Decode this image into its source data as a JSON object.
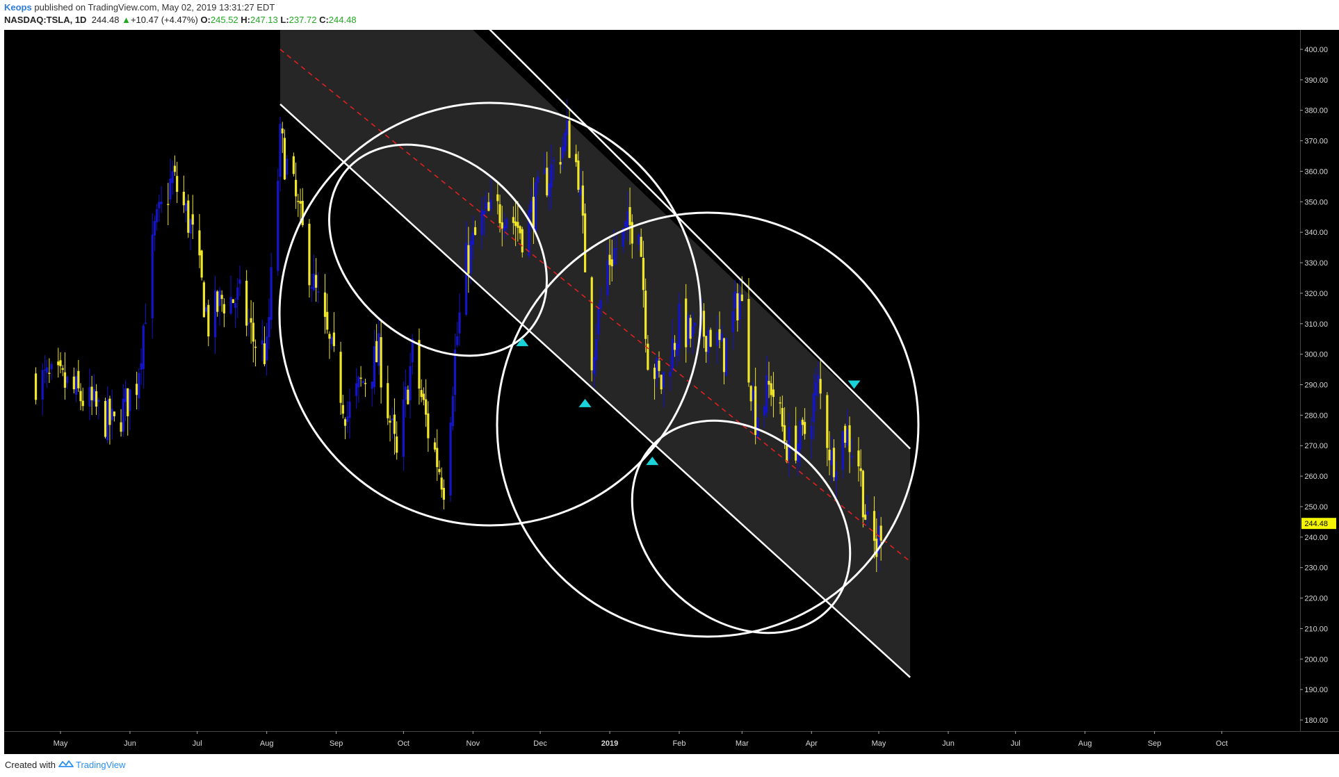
{
  "header": {
    "author": "Keops",
    "published": "published on TradingView.com, May 02, 2019 13:31:27 EDT",
    "symbol": "NASDAQ:TSLA, 1D",
    "last": "244.48",
    "change": "+10.47 (+4.47%)",
    "open_label": "O:",
    "open": "245.52",
    "high_label": "H:",
    "high": "247.13",
    "low_label": "L:",
    "low": "237.72",
    "close_label": "C:",
    "close": "244.48"
  },
  "footer": {
    "created_with": "Created with",
    "brand": "TradingView"
  },
  "colors": {
    "background": "#000000",
    "up_candle": "#1414c8",
    "down_candle": "#f0e62a",
    "channel_fill": "#262626",
    "lines": "#ffffff",
    "midline": "#e02020",
    "arrows": "#19d3d8",
    "price_badge": "#f5f500"
  },
  "chart_data": {
    "type": "candlestick",
    "symbol": "NASDAQ:TSLA",
    "interval": "1D",
    "ylim": [
      175,
      405
    ],
    "y_ticks": [
      180,
      190,
      200,
      210,
      220,
      230,
      240,
      250,
      260,
      270,
      280,
      290,
      300,
      310,
      320,
      330,
      340,
      350,
      360,
      370,
      380,
      390,
      400
    ],
    "x_ticks": [
      "May",
      "Jun",
      "Jul",
      "Aug",
      "Sep",
      "Oct",
      "Nov",
      "Dec",
      "2019",
      "Feb",
      "Mar",
      "Apr",
      "May",
      "Jun",
      "Jul",
      "Aug",
      "Sep",
      "Oct"
    ],
    "x_tick_dates": [
      "2018-05-01",
      "2018-06-01",
      "2018-07-01",
      "2018-08-01",
      "2018-09-01",
      "2018-10-01",
      "2018-11-01",
      "2018-12-01",
      "2019-01-01",
      "2019-02-01",
      "2019-03-01",
      "2019-04-01",
      "2019-05-01",
      "2019-06-01",
      "2019-07-01",
      "2019-08-01",
      "2019-09-01",
      "2019-10-01"
    ],
    "last_price": 244.48,
    "price_path": [
      [
        "2018-04-20",
        292
      ],
      [
        "2018-05-03",
        290
      ],
      [
        "2018-05-15",
        283
      ],
      [
        "2018-05-25",
        276
      ],
      [
        "2018-06-04",
        291
      ],
      [
        "2018-06-12",
        340
      ],
      [
        "2018-06-20",
        358
      ],
      [
        "2018-06-28",
        342
      ],
      [
        "2018-07-06",
        310
      ],
      [
        "2018-07-12",
        318
      ],
      [
        "2018-07-20",
        318
      ],
      [
        "2018-07-26",
        305
      ],
      [
        "2018-08-01",
        300
      ],
      [
        "2018-08-07",
        370
      ],
      [
        "2018-08-14",
        350
      ],
      [
        "2018-08-22",
        322
      ],
      [
        "2018-08-29",
        302
      ],
      [
        "2018-09-06",
        280
      ],
      [
        "2018-09-12",
        290
      ],
      [
        "2018-09-20",
        300
      ],
      [
        "2018-09-28",
        265
      ],
      [
        "2018-10-05",
        300
      ],
      [
        "2018-10-12",
        275
      ],
      [
        "2018-10-19",
        258
      ],
      [
        "2018-10-24",
        300
      ],
      [
        "2018-10-29",
        330
      ],
      [
        "2018-11-05",
        344
      ],
      [
        "2018-11-15",
        348
      ],
      [
        "2018-11-23",
        340
      ],
      [
        "2018-11-29",
        350
      ],
      [
        "2018-12-07",
        362
      ],
      [
        "2018-12-13",
        372
      ],
      [
        "2018-12-18",
        360
      ],
      [
        "2018-12-24",
        300
      ],
      [
        "2018-12-31",
        330
      ],
      [
        "2019-01-08",
        340
      ],
      [
        "2019-01-14",
        345
      ],
      [
        "2019-01-18",
        300
      ],
      [
        "2019-01-24",
        290
      ],
      [
        "2019-02-01",
        310
      ],
      [
        "2019-02-07",
        305
      ],
      [
        "2019-02-14",
        308
      ],
      [
        "2019-02-21",
        300
      ],
      [
        "2019-02-28",
        320
      ],
      [
        "2019-03-07",
        280
      ],
      [
        "2019-03-14",
        290
      ],
      [
        "2019-03-21",
        270
      ],
      [
        "2019-03-28",
        272
      ],
      [
        "2019-04-04",
        290
      ],
      [
        "2019-04-10",
        265
      ],
      [
        "2019-04-16",
        275
      ],
      [
        "2019-04-22",
        265
      ],
      [
        "2019-04-26",
        242
      ],
      [
        "2019-04-30",
        236
      ],
      [
        "2019-05-02",
        244.48
      ]
    ],
    "drawings": {
      "channel_upper": [
        [
          "2018-11-01",
          412
        ],
        [
          "2019-05-15",
          269
        ]
      ],
      "channel_lower": [
        [
          "2018-08-07",
          382
        ],
        [
          "2019-05-15",
          194
        ]
      ],
      "channel_mid": [
        [
          "2018-08-07",
          400
        ],
        [
          "2019-05-15",
          232
        ]
      ],
      "arrows_up": [
        [
          "2018-11-23",
          304
        ],
        [
          "2018-12-21",
          284
        ],
        [
          "2019-01-20",
          265
        ]
      ],
      "arrows_down": [
        [
          "2019-04-20",
          290
        ]
      ]
    }
  }
}
